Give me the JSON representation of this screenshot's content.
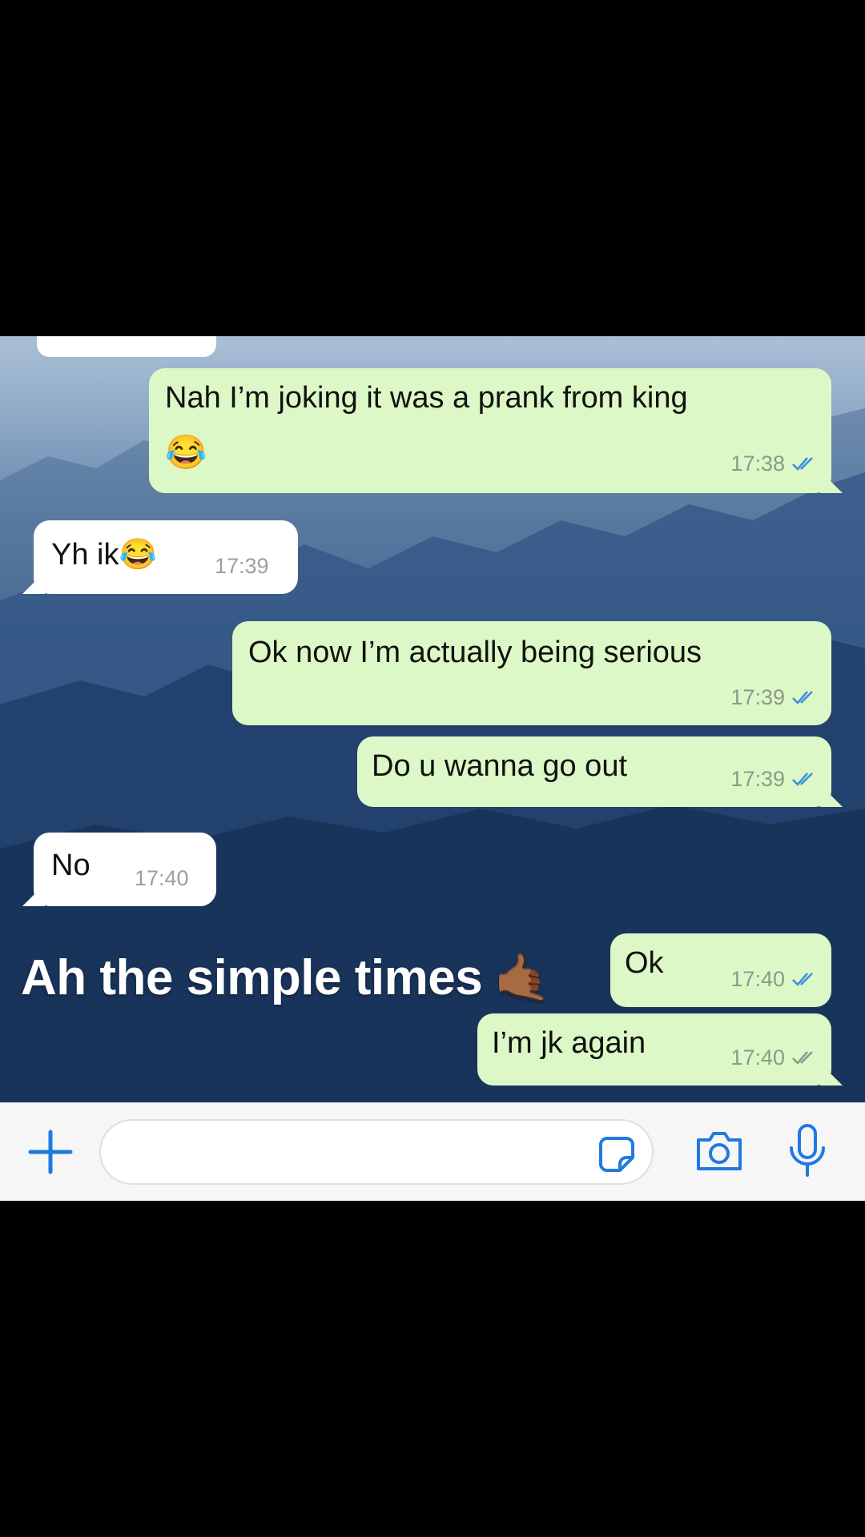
{
  "caption": "Ah the simple times",
  "caption_emoji": "🤙🏾",
  "messages": [
    {
      "direction": "outgoing",
      "text": "Nah I’m joking it was a prank from king",
      "emoji": "😂",
      "time": "17:38",
      "status": "read"
    },
    {
      "direction": "incoming",
      "text": "Yh ik",
      "emoji": "😂",
      "time": "17:39"
    },
    {
      "direction": "outgoing",
      "text": "Ok now I’m actually being serious",
      "time": "17:39",
      "status": "read"
    },
    {
      "direction": "outgoing",
      "text": "Do u wanna go out",
      "time": "17:39",
      "status": "read"
    },
    {
      "direction": "incoming",
      "text": "No",
      "time": "17:40"
    },
    {
      "direction": "outgoing",
      "text": "Ok",
      "time": "17:40",
      "status": "read"
    },
    {
      "direction": "outgoing",
      "text": "I’m jk again",
      "time": "17:40",
      "status": "delivered"
    }
  ],
  "composer": {
    "placeholder": "",
    "value": "",
    "icons": [
      "plus-icon",
      "sticker-icon",
      "camera-icon",
      "microphone-icon"
    ],
    "accent_color": "#1f7ae0"
  },
  "colors": {
    "outgoing_bubble": "#dcf8c6",
    "incoming_bubble": "#ffffff",
    "read_ticks": "#3b8fe0",
    "delivered_ticks": "#8a9a8a"
  }
}
